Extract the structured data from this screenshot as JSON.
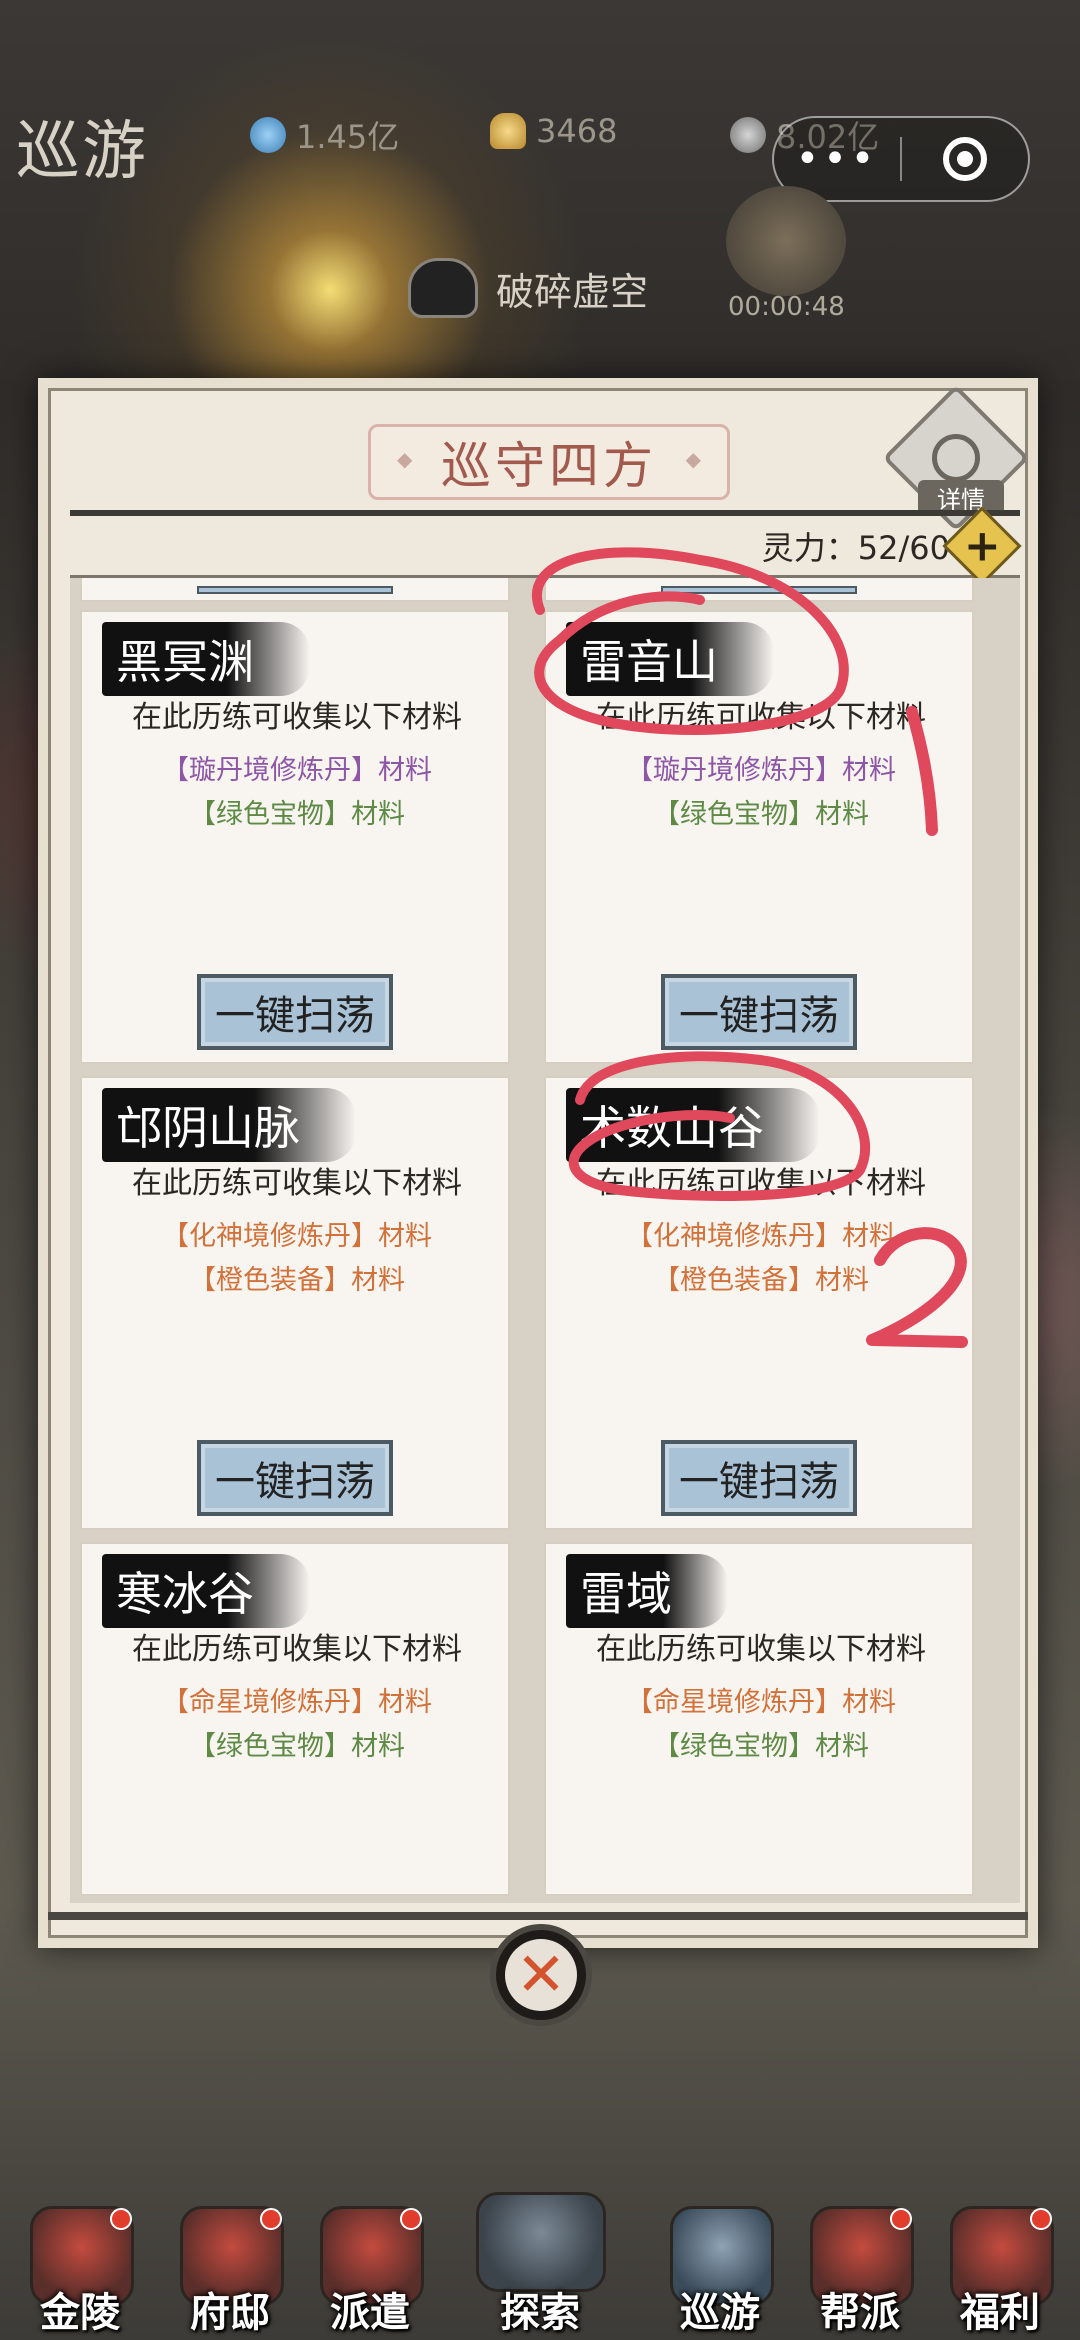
{
  "header": {
    "title": "巡游",
    "resources": [
      {
        "icon": "spirit-stone-icon",
        "value": "1.45亿",
        "color": "#4a8fc9"
      },
      {
        "icon": "gold-ingot-icon",
        "value": "3468",
        "color": "#d6a53a"
      },
      {
        "icon": "sword-icon",
        "value": "8.02亿",
        "color": "#8a8a8a"
      }
    ],
    "event": {
      "label": "破碎虚空",
      "timer": "00:00:48"
    }
  },
  "capsule": {
    "more": "•••"
  },
  "panel": {
    "title": "巡守四方",
    "details_label": "详情",
    "stamina": "灵力：52/60",
    "plus": "+",
    "cards": [
      {
        "name": "黑冥渊",
        "sub": "在此历练可收集以下材料",
        "mat1": "【璇丹境修炼丹】材料",
        "mat1_color": "#8e57a6",
        "mat2": "【绿色宝物】材料",
        "mat2_color": "#5e8a45",
        "button": "一键扫荡"
      },
      {
        "name": "雷音山",
        "sub": "在此历练可收集以下材料",
        "mat1": "【璇丹境修炼丹】材料",
        "mat1_color": "#8e57a6",
        "mat2": "【绿色宝物】材料",
        "mat2_color": "#5e8a45",
        "button": "一键扫荡"
      },
      {
        "name": "邙阴山脉",
        "sub": "在此历练可收集以下材料",
        "mat1": "【化神境修炼丹】材料",
        "mat1_color": "#d2723b",
        "mat2": "【橙色装备】材料",
        "mat2_color": "#d2723b",
        "button": "一键扫荡"
      },
      {
        "name": "术数山谷",
        "sub": "在此历练可收集以下材料",
        "mat1": "【化神境修炼丹】材料",
        "mat1_color": "#d2723b",
        "mat2": "【橙色装备】材料",
        "mat2_color": "#d2723b",
        "button": "一键扫荡"
      },
      {
        "name": "寒冰谷",
        "sub": "在此历练可收集以下材料",
        "mat1": "【命星境修炼丹】材料",
        "mat1_color": "#d2723b",
        "mat2": "【绿色宝物】材料",
        "mat2_color": "#5e8a45"
      },
      {
        "name": "雷域",
        "sub": "在此历练可收集以下材料",
        "mat1": "【命星境修炼丹】材料",
        "mat1_color": "#d2723b",
        "mat2": "【绿色宝物】材料",
        "mat2_color": "#5e8a45"
      }
    ]
  },
  "close": {
    "icon": "close-x-icon",
    "label": "✕"
  },
  "nav": [
    {
      "label": "金陵",
      "dot": true
    },
    {
      "label": "府邸",
      "dot": true
    },
    {
      "label": "派遣",
      "dot": true
    },
    {
      "label": "探索",
      "dot": false,
      "active": true
    },
    {
      "label": "巡游",
      "dot": false
    },
    {
      "label": "帮派",
      "dot": true
    },
    {
      "label": "福利",
      "dot": true
    }
  ],
  "annotations": {
    "mark1": "1",
    "mark2": "2",
    "color": "#e0485c"
  }
}
